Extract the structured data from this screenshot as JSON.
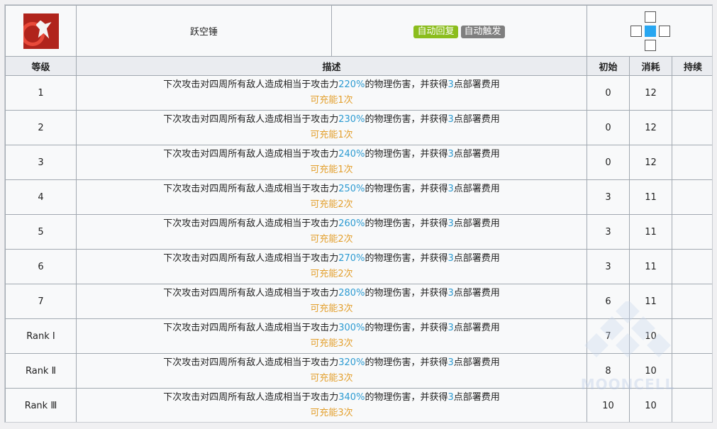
{
  "skill": {
    "icon": "leaping-hammer-skill-icon",
    "name": "跃空锤",
    "tags": [
      {
        "label": "自动回复",
        "color": "#8bbd1d"
      },
      {
        "label": "自动触发",
        "color": "#7f7f7f"
      }
    ]
  },
  "columns": {
    "level": "等级",
    "description": "描述",
    "initial": "初始",
    "cost": "消耗",
    "duration": "持续"
  },
  "colors": {
    "highlight": "#2d9bd2",
    "charge": "#e3a02e",
    "range_self": "#27a6f1"
  },
  "levels": [
    {
      "level": "1",
      "desc_prefix": "下次攻击对四周所有敌人造成相当于攻击力",
      "percent": "220%",
      "desc_middle": "的物理伤害，并获得",
      "sp": "3",
      "desc_suffix": "点部署费用",
      "charge": "可充能1次",
      "initial": "0",
      "cost": "12",
      "duration": ""
    },
    {
      "level": "2",
      "desc_prefix": "下次攻击对四周所有敌人造成相当于攻击力",
      "percent": "230%",
      "desc_middle": "的物理伤害，并获得",
      "sp": "3",
      "desc_suffix": "点部署费用",
      "charge": "可充能1次",
      "initial": "0",
      "cost": "12",
      "duration": ""
    },
    {
      "level": "3",
      "desc_prefix": "下次攻击对四周所有敌人造成相当于攻击力",
      "percent": "240%",
      "desc_middle": "的物理伤害，并获得",
      "sp": "3",
      "desc_suffix": "点部署费用",
      "charge": "可充能1次",
      "initial": "0",
      "cost": "12",
      "duration": ""
    },
    {
      "level": "4",
      "desc_prefix": "下次攻击对四周所有敌人造成相当于攻击力",
      "percent": "250%",
      "desc_middle": "的物理伤害，并获得",
      "sp": "3",
      "desc_suffix": "点部署费用",
      "charge": "可充能2次",
      "initial": "3",
      "cost": "11",
      "duration": ""
    },
    {
      "level": "5",
      "desc_prefix": "下次攻击对四周所有敌人造成相当于攻击力",
      "percent": "260%",
      "desc_middle": "的物理伤害，并获得",
      "sp": "3",
      "desc_suffix": "点部署费用",
      "charge": "可充能2次",
      "initial": "3",
      "cost": "11",
      "duration": ""
    },
    {
      "level": "6",
      "desc_prefix": "下次攻击对四周所有敌人造成相当于攻击力",
      "percent": "270%",
      "desc_middle": "的物理伤害，并获得",
      "sp": "3",
      "desc_suffix": "点部署费用",
      "charge": "可充能2次",
      "initial": "3",
      "cost": "11",
      "duration": ""
    },
    {
      "level": "7",
      "desc_prefix": "下次攻击对四周所有敌人造成相当于攻击力",
      "percent": "280%",
      "desc_middle": "的物理伤害，并获得",
      "sp": "3",
      "desc_suffix": "点部署费用",
      "charge": "可充能3次",
      "initial": "6",
      "cost": "11",
      "duration": ""
    },
    {
      "level": "Rank Ⅰ",
      "desc_prefix": "下次攻击对四周所有敌人造成相当于攻击力",
      "percent": "300%",
      "desc_middle": "的物理伤害，并获得",
      "sp": "3",
      "desc_suffix": "点部署费用",
      "charge": "可充能3次",
      "initial": "7",
      "cost": "10",
      "duration": ""
    },
    {
      "level": "Rank Ⅱ",
      "desc_prefix": "下次攻击对四周所有敌人造成相当于攻击力",
      "percent": "320%",
      "desc_middle": "的物理伤害，并获得",
      "sp": "3",
      "desc_suffix": "点部署费用",
      "charge": "可充能3次",
      "initial": "8",
      "cost": "10",
      "duration": ""
    },
    {
      "level": "Rank Ⅲ",
      "desc_prefix": "下次攻击对四周所有敌人造成相当于攻击力",
      "percent": "340%",
      "desc_middle": "的物理伤害，并获得",
      "sp": "3",
      "desc_suffix": "点部署费用",
      "charge": "可充能3次",
      "initial": "10",
      "cost": "10",
      "duration": ""
    }
  ],
  "watermark": {
    "text": "MOONCELL"
  }
}
